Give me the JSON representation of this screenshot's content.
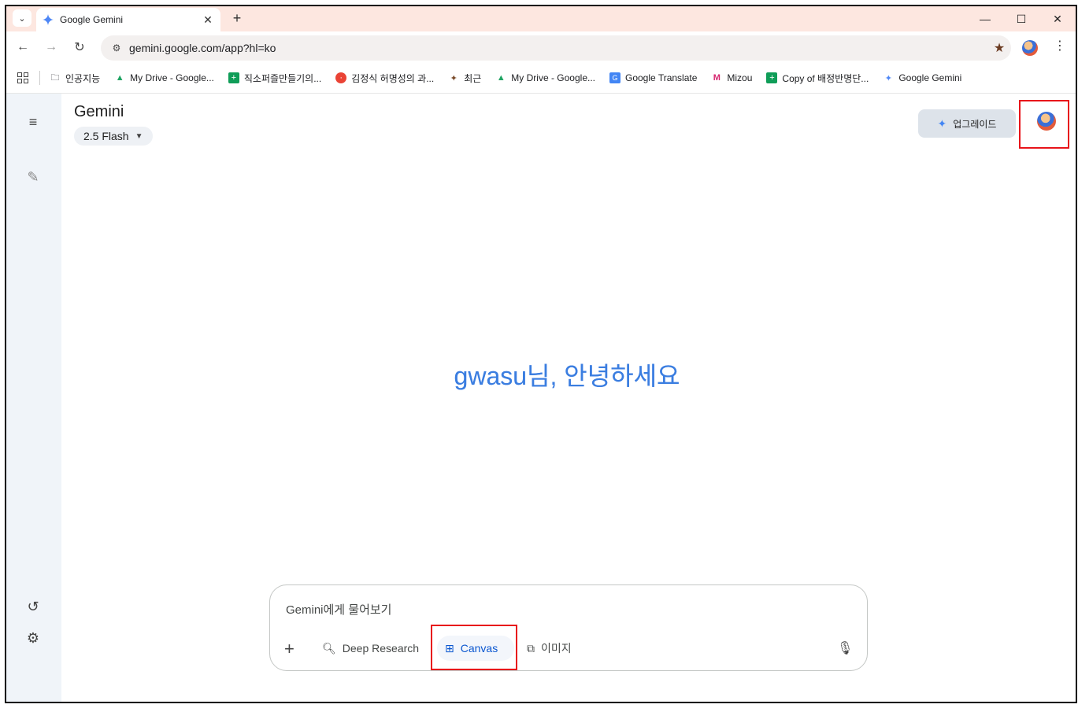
{
  "browser": {
    "tab_title": "Google Gemini",
    "tab_close": "✕",
    "new_tab": "+",
    "tab_search": "⌄",
    "window_controls": [
      "—",
      "☐",
      "✕"
    ],
    "url": "gemini.google.com/app?hl=ko",
    "bookmarks": [
      {
        "label": "인공지능",
        "icon": "folder-icon"
      },
      {
        "label": "My Drive - Google...",
        "icon": "google-drive-icon"
      },
      {
        "label": "직소퍼즐만들기의...",
        "icon": "google-sheets-icon"
      },
      {
        "label": "김정식 허명성의 과...",
        "icon": "red-circle-icon"
      },
      {
        "label": "최근",
        "icon": "bird-icon"
      },
      {
        "label": "My Drive - Google...",
        "icon": "google-drive-icon"
      },
      {
        "label": "Google Translate",
        "icon": "translate-icon"
      },
      {
        "label": "Mizou",
        "icon": "mizou-icon"
      },
      {
        "label": "Copy of 배정반명단...",
        "icon": "google-sheets-icon"
      },
      {
        "label": "Google Gemini",
        "icon": "gemini-icon"
      }
    ]
  },
  "header": {
    "app_title": "Gemini",
    "model_label": "2.5 Flash",
    "upgrade_label": "업그레이드"
  },
  "main": {
    "greeting": "gwasu님, 안녕하세요"
  },
  "composer": {
    "placeholder": "Gemini에게 물어보기",
    "tools": {
      "deep_research": "Deep Research",
      "canvas": "Canvas",
      "image": "이미지"
    }
  },
  "colors": {
    "tab_strip": "#fde7e0",
    "accent_blue": "#0b57d0",
    "greeting_blue": "#3b7ee0",
    "highlight_red": "#e8141a",
    "sidebar_bg": "#f0f4f9"
  }
}
